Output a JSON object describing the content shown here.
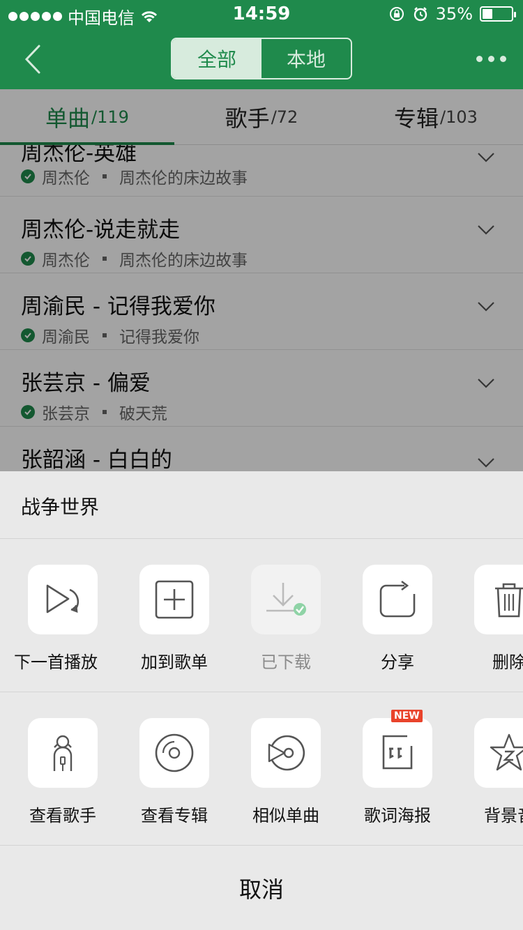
{
  "status_bar": {
    "carrier": "中国电信",
    "time": "14:59",
    "battery": "35%",
    "battery_level": 0.35
  },
  "nav": {
    "segments": [
      {
        "label": "全部",
        "active": true
      },
      {
        "label": "本地",
        "active": false
      }
    ],
    "colors": {
      "brand": "#1f8a4c"
    }
  },
  "tabs": [
    {
      "label": "单曲",
      "count": "/119",
      "active": true
    },
    {
      "label": "歌手",
      "count": "/72",
      "active": false
    },
    {
      "label": "专辑",
      "count": "/103",
      "active": false
    }
  ],
  "songs": [
    {
      "title": "周杰伦-英雄",
      "artist": "周杰伦",
      "album": "周杰伦的床边故事"
    },
    {
      "title": "周杰伦-说走就走",
      "artist": "周杰伦",
      "album": "周杰伦的床边故事"
    },
    {
      "title": "周渝民 - 记得我爱你",
      "artist": "周渝民",
      "album": "记得我爱你"
    },
    {
      "title": "张芸京 - 偏爱",
      "artist": "张芸京",
      "album": "破天荒"
    },
    {
      "title": "张韶涵 - 白白的",
      "artist": "",
      "album": ""
    }
  ],
  "sheet": {
    "title": "战争世界",
    "row1": [
      {
        "label": "下一首播放",
        "icon": "play-next-icon"
      },
      {
        "label": "加到歌单",
        "icon": "add-to-playlist-icon"
      },
      {
        "label": "已下载",
        "icon": "downloaded-icon",
        "disabled": true
      },
      {
        "label": "分享",
        "icon": "share-icon"
      },
      {
        "label": "删除",
        "icon": "trash-icon"
      }
    ],
    "row2": [
      {
        "label": "查看歌手",
        "icon": "singer-icon"
      },
      {
        "label": "查看专辑",
        "icon": "album-icon"
      },
      {
        "label": "相似单曲",
        "icon": "similar-songs-icon"
      },
      {
        "label": "歌词海报",
        "icon": "lyrics-poster-icon",
        "badge": "NEW"
      },
      {
        "label": "背景音",
        "icon": "background-sound-icon"
      }
    ],
    "cancel": "取消"
  }
}
